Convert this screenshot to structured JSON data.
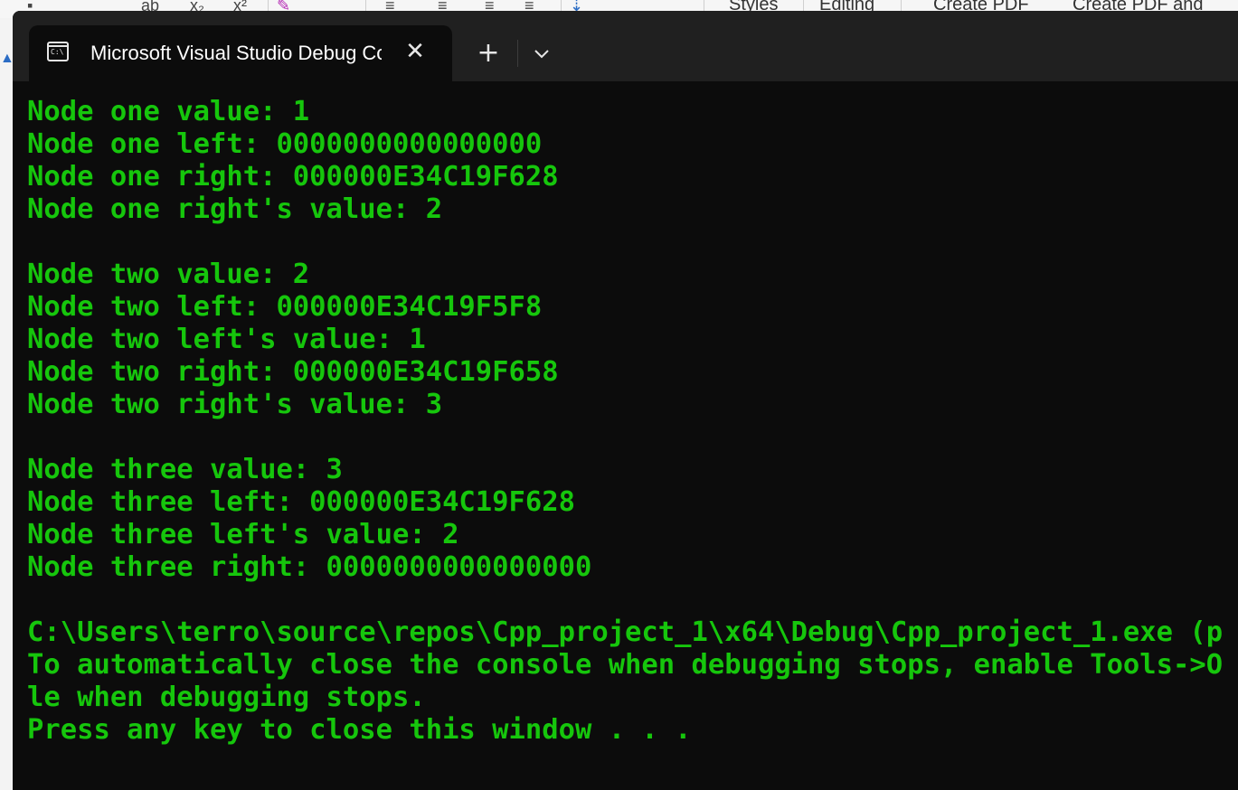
{
  "background_app": {
    "ribbon": {
      "styles_label": "Styles",
      "editing_label": "Editing",
      "create_pdf_label": "Create PDF",
      "create_pdf_and_label": "Create PDF and"
    }
  },
  "window": {
    "tab": {
      "icon": "console-app-icon",
      "title": "Microsoft Visual Studio Debug Console"
    },
    "close_icon": "close-icon",
    "new_tab_icon": "plus-icon",
    "dropdown_icon": "chevron-down-icon",
    "colors": {
      "titlebar": "#202020",
      "background": "#0c0c0c",
      "text": "#16c60c"
    }
  },
  "console": {
    "lines": [
      "Node one value: 1",
      "Node one left: 0000000000000000",
      "Node one right: 000000E34C19F628",
      "Node one right's value: 2",
      "",
      "Node two value: 2",
      "Node two left: 000000E34C19F5F8",
      "Node two left's value: 1",
      "Node two right: 000000E34C19F658",
      "Node two right's value: 3",
      "",
      "Node three value: 3",
      "Node three left: 000000E34C19F628",
      "Node three left's value: 2",
      "Node three right: 0000000000000000",
      "",
      "C:\\Users\\terro\\source\\repos\\Cpp_project_1\\x64\\Debug\\Cpp_project_1.exe (p",
      "To automatically close the console when debugging stops, enable Tools->O",
      "le when debugging stops.",
      "Press any key to close this window . . ."
    ]
  }
}
